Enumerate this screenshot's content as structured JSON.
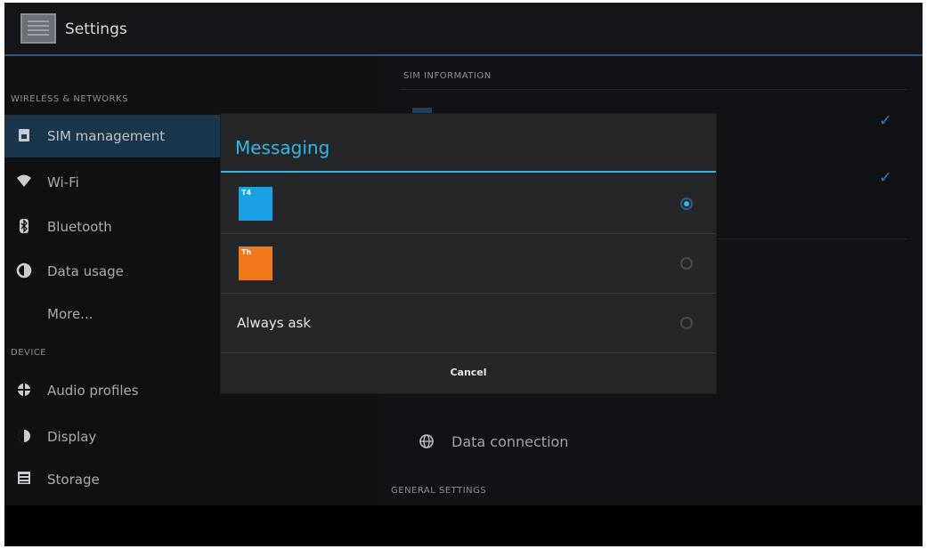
{
  "actionbar": {
    "title": "Settings",
    "icon": "settings-app-icon"
  },
  "left_pane": {
    "sections": [
      {
        "header": "WIRELESS & NETWORKS",
        "items": [
          {
            "label": "SIM management",
            "icon": "sim-icon",
            "selected": true
          },
          {
            "label": "Wi-Fi",
            "icon": "wifi-icon"
          },
          {
            "label": "Bluetooth",
            "icon": "bluetooth-icon"
          },
          {
            "label": "Data usage",
            "icon": "data-usage-icon"
          },
          {
            "label": "More...",
            "icon": ""
          }
        ]
      },
      {
        "header": "DEVICE",
        "items": [
          {
            "label": "Audio profiles",
            "icon": "audio-profiles-icon"
          },
          {
            "label": "Display",
            "icon": "display-icon"
          },
          {
            "label": "Storage",
            "icon": "storage-icon"
          }
        ]
      }
    ]
  },
  "right_pane": {
    "sim_information_header": "SIM INFORMATION",
    "data_connection_label": "Data connection",
    "general_settings_header": "GENERAL SETTINGS"
  },
  "dialog": {
    "title": "Messaging",
    "options": [
      {
        "label": "",
        "badge_color": "#1aa1e6",
        "badge_tag": "T4",
        "checked": true
      },
      {
        "label": "",
        "badge_color": "#f07a1a",
        "badge_tag": "Th",
        "checked": false
      },
      {
        "label": "Always ask",
        "checked": false
      }
    ],
    "cancel_label": "Cancel"
  },
  "colors": {
    "accent": "#33b5e5",
    "selected_bg": "#19364d"
  }
}
